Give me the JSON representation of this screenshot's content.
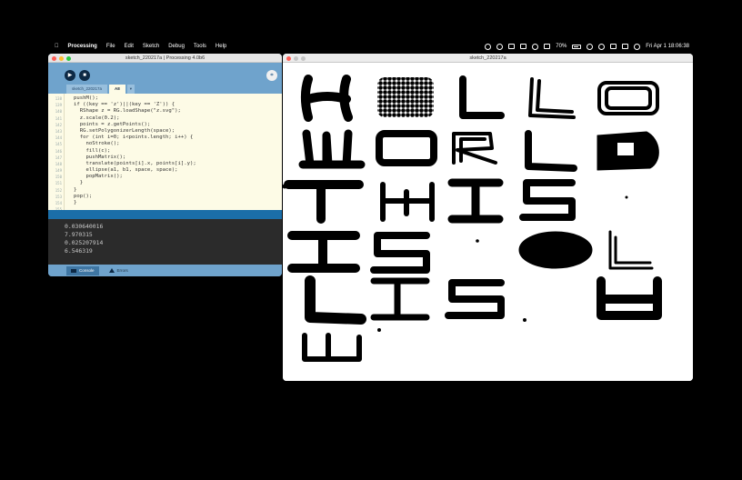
{
  "menubar": {
    "apple": "",
    "app_name": "Processing",
    "menus": [
      "File",
      "Edit",
      "Sketch",
      "Debug",
      "Tools",
      "Help"
    ],
    "battery": "70%",
    "clock": "Fri Apr 1  18:06:38"
  },
  "ide": {
    "title": "sketch_220217a | Processing 4.0b6",
    "run_icon": "play-icon",
    "stop_icon": "stop-icon",
    "mode_label": "⌗",
    "tabs": [
      "sketch_220217a",
      "A8",
      "▾"
    ],
    "line_numbers": [
      "138",
      "139",
      "140",
      "141",
      "142",
      "143",
      "144",
      "145",
      "146",
      "147",
      "148",
      "149",
      "150",
      "151",
      "152",
      "153",
      "154",
      "155",
      "156"
    ],
    "code": [
      "pushM();",
      "if ((key == 'z')||(key == 'Z')) {",
      "  RShape z = RG.loadShape(\"z.svg\");",
      "  z.scale(0.2);",
      "  points = z.getPoints();",
      "  RG.setPolygonizerLength(space);",
      "  for (int i=0; i<points.length; i++) {",
      "    noStroke();",
      "    fill(c);",
      "    pushMatrix();",
      "    translate(points[i].x, points[i].y);",
      "    ellipse(a1, b1, space, space);",
      "    popMatrix();",
      "  }",
      "}",
      "pop();",
      "}",
      "",
      ""
    ],
    "console_lines": [
      "0.030640016",
      "7.970315",
      "0.025207914",
      "6.546319"
    ],
    "status_tabs": [
      "Console",
      "Errors"
    ]
  },
  "sketch": {
    "title": "sketch_220217a"
  }
}
